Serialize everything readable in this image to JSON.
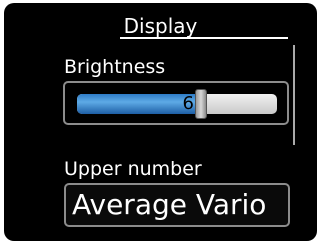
{
  "header": {
    "title": "Display"
  },
  "brightness": {
    "label": "Brightness",
    "value": "6",
    "level": 0.6,
    "accent": "#2e7cc7"
  },
  "upper_number": {
    "label": "Upper number",
    "value": "Average Vario"
  }
}
